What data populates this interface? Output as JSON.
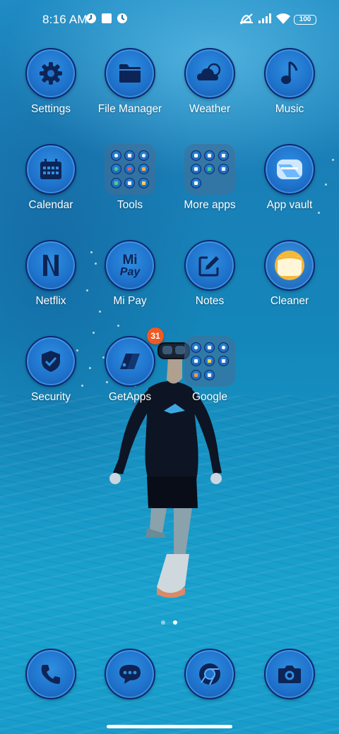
{
  "status_bar": {
    "time": "8:16 AM",
    "battery": "100",
    "icons": [
      "clock-icon",
      "square-icon",
      "clock-icon",
      "mute-icon",
      "signal-icon",
      "wifi-icon",
      "battery-icon"
    ]
  },
  "apps": [
    {
      "label": "Settings",
      "icon": "gear-icon"
    },
    {
      "label": "File Manager",
      "icon": "folder-icon"
    },
    {
      "label": "Weather",
      "icon": "cloud-icon"
    },
    {
      "label": "Music",
      "icon": "music-note-icon"
    },
    {
      "label": "Calendar",
      "icon": "calendar-icon"
    },
    {
      "label": "Tools",
      "icon": "folder-tools-icon"
    },
    {
      "label": "More apps",
      "icon": "folder-more-apps-icon"
    },
    {
      "label": "App vault",
      "icon": "app-vault-icon"
    },
    {
      "label": "Netflix",
      "icon": "netflix-icon"
    },
    {
      "label": "Mi Pay",
      "icon": "mi-pay-icon",
      "logo_text": [
        "Mi",
        "Pay"
      ]
    },
    {
      "label": "Notes",
      "icon": "notes-icon"
    },
    {
      "label": "Cleaner",
      "icon": "cleaner-icon"
    },
    {
      "label": "Security",
      "icon": "shield-icon"
    },
    {
      "label": "GetApps",
      "icon": "getapps-icon",
      "badge": "31"
    },
    {
      "label": "Google",
      "icon": "folder-google-icon"
    }
  ],
  "dock": [
    {
      "name": "phone",
      "icon": "phone-icon"
    },
    {
      "name": "messages",
      "icon": "message-icon"
    },
    {
      "name": "chrome",
      "icon": "chrome-icon"
    },
    {
      "name": "camera",
      "icon": "camera-icon"
    }
  ],
  "page_indicator": {
    "pages": 2,
    "active": 2
  },
  "colors": {
    "icon_bg": "#1f73cc",
    "icon_ring": "#0d2a6e",
    "glyph": "#0d2456",
    "badge": "#ef5a22"
  }
}
